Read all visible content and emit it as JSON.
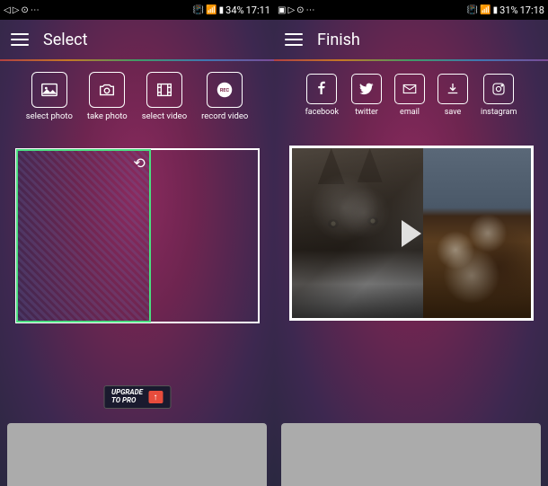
{
  "left": {
    "status": {
      "battery": "34%",
      "time": "17:11"
    },
    "title": "Select",
    "actions": [
      {
        "label": "select photo",
        "icon": "photo-icon"
      },
      {
        "label": "take photo",
        "icon": "camera-icon"
      },
      {
        "label": "select video",
        "icon": "film-icon"
      },
      {
        "label": "record video",
        "icon": "record-icon"
      }
    ],
    "upgrade": {
      "line1": "UPGRADE",
      "line2": "TO PRO"
    }
  },
  "right": {
    "status": {
      "battery": "31%",
      "time": "17:18"
    },
    "title": "Finish",
    "actions": [
      {
        "label": "facebook",
        "icon": "facebook-icon"
      },
      {
        "label": "twitter",
        "icon": "twitter-icon"
      },
      {
        "label": "email",
        "icon": "email-icon"
      },
      {
        "label": "save",
        "icon": "save-icon"
      },
      {
        "label": "instagram",
        "icon": "instagram-icon"
      }
    ]
  }
}
